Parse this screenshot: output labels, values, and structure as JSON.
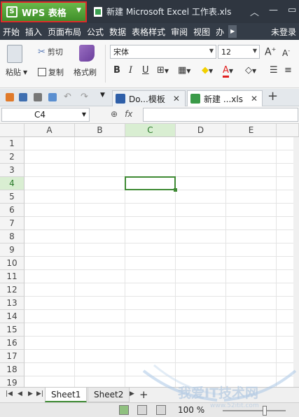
{
  "app": {
    "menu_button_label": "WPS 表格",
    "document_title": "新建 Microsoft Excel 工作表.xls"
  },
  "menu": {
    "items": [
      "开始",
      "插入",
      "页面布局",
      "公式",
      "数据",
      "表格样式",
      "审阅",
      "视图",
      "办"
    ],
    "login": "未登录"
  },
  "ribbon": {
    "paste": "粘贴",
    "cut": "剪切",
    "copy": "复制",
    "format_painter": "格式刷",
    "font_name": "宋体",
    "font_size": "12",
    "bold": "B",
    "italic": "I",
    "underline": "U",
    "grow_font": "A",
    "shrink_font": "A",
    "font_color_label": "A",
    "font_color": "#e02020",
    "fill_color": "#f2d000"
  },
  "doc_tabs": [
    {
      "label": "Do...模板"
    },
    {
      "label": "新建 ...xls"
    }
  ],
  "formula_bar": {
    "cell_ref": "C4",
    "fx": "fx",
    "formula": ""
  },
  "grid": {
    "columns": [
      "A",
      "B",
      "C",
      "D",
      "E"
    ],
    "rows": [
      "1",
      "2",
      "3",
      "4",
      "5",
      "6",
      "7",
      "8",
      "9",
      "10",
      "11",
      "12",
      "13",
      "14",
      "15",
      "16",
      "17",
      "18",
      "19"
    ],
    "selected": {
      "column": "C",
      "row": "4"
    }
  },
  "sheets": [
    "Sheet1",
    "Sheet2"
  ],
  "status": {
    "zoom": "100 %"
  },
  "watermark": {
    "text": "我爱IT技术网",
    "url": "www.52itit.com"
  }
}
